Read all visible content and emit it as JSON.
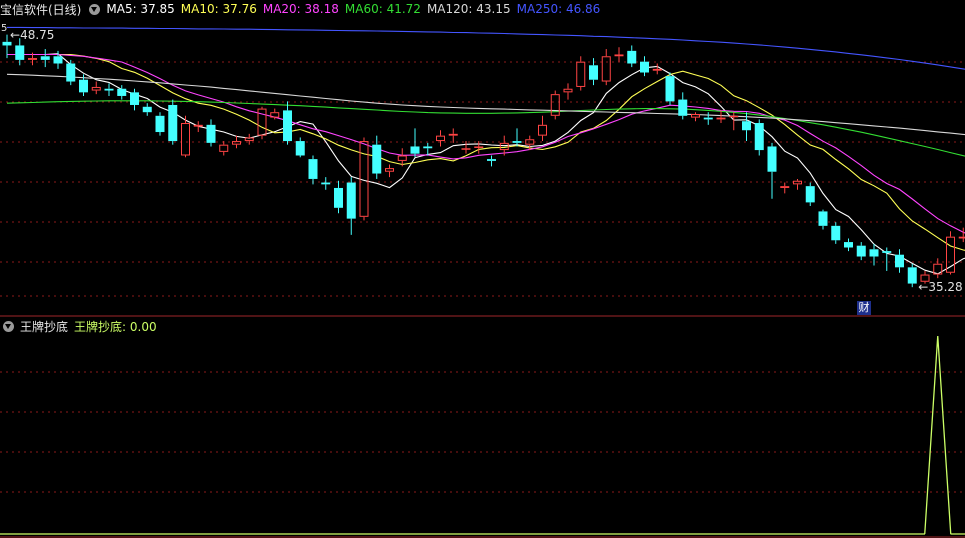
{
  "header": {
    "title": "宝信软件(日线)",
    "ma": [
      {
        "label": "MA5: 37.85",
        "color": "#ffffff"
      },
      {
        "label": "MA10: 37.76",
        "color": "#ffff55"
      },
      {
        "label": "MA20: 38.18",
        "color": "#ff44ff"
      },
      {
        "label": "MA60: 41.72",
        "color": "#33dd33"
      },
      {
        "label": "MA120: 43.15",
        "color": "#d8d8d8"
      },
      {
        "label": "MA250: 46.86",
        "color": "#4455ff"
      }
    ]
  },
  "indicator": {
    "name": "王牌抄底",
    "value_label": "王牌抄底: 0.00",
    "color": "#ccff66"
  },
  "annotations": {
    "high_label": "48.75",
    "low_label": "35.28",
    "left_axis_label": "5",
    "badge": "财"
  },
  "colors": {
    "up": "#ff4444",
    "down": "#44ffff",
    "grid": "#8b1a1a"
  },
  "chart_data": {
    "type": "candlestick",
    "ylim": [
      34.2,
      49.5
    ],
    "candles": [
      [
        48.4,
        48.2,
        48.8,
        47.5
      ],
      [
        48.2,
        47.4,
        48.6,
        47.1
      ],
      [
        47.4,
        47.5,
        47.8,
        47.1
      ],
      [
        47.6,
        47.4,
        48.0,
        47.0
      ],
      [
        47.6,
        47.2,
        47.9,
        46.9
      ],
      [
        47.2,
        46.2,
        47.4,
        46.0
      ],
      [
        46.3,
        45.6,
        46.6,
        45.4
      ],
      [
        45.7,
        45.9,
        46.2,
        45.5
      ],
      [
        45.8,
        45.7,
        46.1,
        45.4
      ],
      [
        45.8,
        45.4,
        46.0,
        45.2
      ],
      [
        45.6,
        44.9,
        45.8,
        44.6
      ],
      [
        44.8,
        44.5,
        45.0,
        44.3
      ],
      [
        44.3,
        43.4,
        44.5,
        43.2
      ],
      [
        44.9,
        42.9,
        45.2,
        42.7
      ],
      [
        42.1,
        43.9,
        44.3,
        42.0
      ],
      [
        43.7,
        43.8,
        44.0,
        43.4
      ],
      [
        43.8,
        42.8,
        44.1,
        42.6
      ],
      [
        42.3,
        42.7,
        42.9,
        42.1
      ],
      [
        42.7,
        42.9,
        43.2,
        42.5
      ],
      [
        42.9,
        43.1,
        43.3,
        42.7
      ],
      [
        43.2,
        44.7,
        44.8,
        43.0
      ],
      [
        44.2,
        44.5,
        44.7,
        44.1
      ],
      [
        44.6,
        42.9,
        45.1,
        42.7
      ],
      [
        42.9,
        42.1,
        43.1,
        42.0
      ],
      [
        41.9,
        40.8,
        42.1,
        40.5
      ],
      [
        40.6,
        40.5,
        40.9,
        40.2
      ],
      [
        40.3,
        39.2,
        40.7,
        38.9
      ],
      [
        40.6,
        38.6,
        40.9,
        37.7
      ],
      [
        38.7,
        42.9,
        43.1,
        38.5
      ],
      [
        42.7,
        41.1,
        43.2,
        40.8
      ],
      [
        41.2,
        41.4,
        41.6,
        40.9
      ],
      [
        41.8,
        42.1,
        42.5,
        41.5
      ],
      [
        42.6,
        42.2,
        43.6,
        42.0
      ],
      [
        42.6,
        42.5,
        42.8,
        42.1
      ],
      [
        42.9,
        43.2,
        43.5,
        42.6
      ],
      [
        43.2,
        43.3,
        43.6,
        42.8
      ],
      [
        42.5,
        42.5,
        42.9,
        42.2
      ],
      [
        42.6,
        42.6,
        42.9,
        42.2
      ],
      [
        41.9,
        41.8,
        42.1,
        41.5
      ],
      [
        42.4,
        42.8,
        43.2,
        42.1
      ],
      [
        42.9,
        42.8,
        43.6,
        42.6
      ],
      [
        42.7,
        43.0,
        43.2,
        42.4
      ],
      [
        43.2,
        43.8,
        44.3,
        42.9
      ],
      [
        44.3,
        45.5,
        45.7,
        44.1
      ],
      [
        45.6,
        45.8,
        46.1,
        45.2
      ],
      [
        45.9,
        47.3,
        47.6,
        45.7
      ],
      [
        47.1,
        46.3,
        47.5,
        46.0
      ],
      [
        46.2,
        47.6,
        48.0,
        46.0
      ],
      [
        47.6,
        47.7,
        48.1,
        47.3
      ],
      [
        47.9,
        47.2,
        48.2,
        47.0
      ],
      [
        47.3,
        46.7,
        47.6,
        46.5
      ],
      [
        46.8,
        46.9,
        47.2,
        46.6
      ],
      [
        46.5,
        45.1,
        46.7,
        44.9
      ],
      [
        45.2,
        44.3,
        45.6,
        44.1
      ],
      [
        44.2,
        44.4,
        44.5,
        44.0
      ],
      [
        44.2,
        44.1,
        44.5,
        43.8
      ],
      [
        44.1,
        44.2,
        44.6,
        43.9
      ],
      [
        44.3,
        44.3,
        44.5,
        43.5
      ],
      [
        44.0,
        43.5,
        44.5,
        42.9
      ],
      [
        43.9,
        42.4,
        44.1,
        42.1
      ],
      [
        42.6,
        41.2,
        42.8,
        39.7
      ],
      [
        40.3,
        40.4,
        40.6,
        40.0
      ],
      [
        40.5,
        40.7,
        40.8,
        40.2
      ],
      [
        40.4,
        39.5,
        40.6,
        39.3
      ],
      [
        39.0,
        38.2,
        39.1,
        38.0
      ],
      [
        38.2,
        37.4,
        38.4,
        37.2
      ],
      [
        37.3,
        37.0,
        37.5,
        36.8
      ],
      [
        37.1,
        36.5,
        37.3,
        36.3
      ],
      [
        36.9,
        36.5,
        37.2,
        36.0
      ],
      [
        36.8,
        36.7,
        37.0,
        35.7
      ],
      [
        36.6,
        35.9,
        36.9,
        35.6
      ],
      [
        35.9,
        35.0,
        36.1,
        34.8
      ],
      [
        35.1,
        35.5,
        35.7,
        35.0
      ],
      [
        35.5,
        36.1,
        36.4,
        35.3
      ],
      [
        35.6,
        37.6,
        37.9,
        35.5
      ],
      [
        37.5,
        37.6,
        38.1,
        37.3
      ],
      [
        37.3,
        36.7,
        37.6,
        36.4
      ]
    ],
    "ma_lines": [
      {
        "name": "MA5",
        "color": "#ffffff",
        "values": [
          47.7,
          47.7,
          47.7,
          47.7,
          47.74,
          47.14,
          46.66,
          46.3,
          46.15,
          45.76,
          45.5,
          45.26,
          44.78,
          44.5,
          44.06,
          43.72,
          43.56,
          43.4,
          43.16,
          43.06,
          43.24,
          43.42,
          43.7,
          43.98,
          43.84,
          42.86,
          41.8,
          40.94,
          40.72,
          40.56,
          40.32,
          40.86,
          41.98,
          42.16,
          42.26,
          42.64,
          42.72,
          42.74,
          42.68,
          42.64,
          42.7,
          42.6,
          42.66,
          42.9,
          43.38,
          44.04,
          44.48,
          45.54,
          46.14,
          46.58,
          46.96,
          47.04,
          46.64,
          46.14,
          45.9,
          45.52,
          44.82,
          44.06,
          44.08,
          43.74,
          43.14,
          42.34,
          41.96,
          41.12,
          40.0,
          39.1,
          38.72,
          37.98,
          37.18,
          36.68,
          36.52,
          36.12,
          35.74,
          35.54,
          35.94,
          36.38,
          36.58
        ]
      },
      {
        "name": "MA10",
        "color": "#ffff55",
        "values": [
          47.7,
          47.7,
          47.7,
          47.7,
          47.7,
          47.7,
          47.61,
          47.48,
          47.3,
          46.92,
          46.71,
          46.38,
          45.98,
          45.57,
          45.25,
          45.0,
          44.88,
          44.67,
          44.39,
          44.06,
          43.66,
          43.36,
          43.41,
          43.54,
          43.3,
          43.02,
          42.67,
          42.41,
          42.19,
          42.05,
          41.76,
          41.6,
          41.71,
          41.86,
          41.93,
          41.8,
          42.09,
          42.44,
          42.53,
          42.55,
          42.65,
          42.52,
          42.43,
          42.58,
          42.83,
          43.4,
          43.61,
          44.04,
          44.66,
          45.36,
          45.8,
          46.2,
          46.59,
          46.77,
          46.57,
          46.37,
          45.99,
          45.41,
          45.14,
          44.75,
          44.34,
          43.81,
          43.23,
          42.68,
          42.44,
          41.88,
          41.36,
          40.77,
          40.42,
          40.01,
          39.14,
          38.47,
          38.02,
          37.54,
          37.08,
          36.86,
          36.73
        ]
      },
      {
        "name": "MA20",
        "color": "#ff44ff",
        "values": [
          47.7,
          47.7,
          47.7,
          47.7,
          47.7,
          47.65,
          47.6,
          47.5,
          47.4,
          47.28,
          47.0,
          46.7,
          46.36,
          45.99,
          45.68,
          45.46,
          45.26,
          45.06,
          44.8,
          44.58,
          44.4,
          44.22,
          44.03,
          43.8,
          43.58,
          43.42,
          43.2,
          42.98,
          42.74,
          42.48,
          42.24,
          42.11,
          42.12,
          42.13,
          42.01,
          41.91,
          41.97,
          42.11,
          42.17,
          42.24,
          42.31,
          42.44,
          42.58,
          42.83,
          43.15,
          43.36,
          43.58,
          43.83,
          44.09,
          44.39,
          44.57,
          44.72,
          44.89,
          44.85,
          44.79,
          44.71,
          44.59,
          44.55,
          44.54,
          44.44,
          44.23,
          44.06,
          43.76,
          43.32,
          42.89,
          42.52,
          42.05,
          41.54,
          41.0,
          40.55,
          40.22,
          39.69,
          39.14,
          38.6,
          38.2,
          37.85,
          37.52
        ]
      },
      {
        "name": "MA60",
        "color": "#33dd33",
        "values": [
          45.0,
          45.02,
          45.04,
          45.06,
          45.08,
          45.1,
          45.11,
          45.12,
          45.13,
          45.13,
          45.13,
          45.13,
          45.12,
          45.11,
          45.1,
          45.08,
          45.06,
          45.04,
          45.01,
          44.98,
          44.95,
          44.92,
          44.89,
          44.86,
          44.82,
          44.78,
          44.74,
          44.7,
          44.66,
          44.62,
          44.58,
          44.54,
          44.51,
          44.48,
          44.46,
          44.45,
          44.44,
          44.44,
          44.44,
          44.45,
          44.46,
          44.48,
          44.5,
          44.53,
          44.56,
          44.59,
          44.62,
          44.65,
          44.67,
          44.69,
          44.7,
          44.7,
          44.69,
          44.67,
          44.64,
          44.6,
          44.55,
          44.49,
          44.42,
          44.34,
          44.25,
          44.15,
          44.04,
          43.92,
          43.8,
          43.67,
          43.53,
          43.39,
          43.24,
          43.08,
          42.92,
          42.76,
          42.6,
          42.43,
          42.26,
          42.09,
          41.92
        ]
      },
      {
        "name": "MA120",
        "color": "#d8d8d8",
        "values": [
          46.6,
          46.58,
          46.55,
          46.52,
          46.49,
          46.45,
          46.41,
          46.37,
          46.33,
          46.28,
          46.23,
          46.18,
          46.13,
          46.07,
          46.01,
          45.95,
          45.89,
          45.82,
          45.75,
          45.68,
          45.61,
          45.54,
          45.47,
          45.4,
          45.33,
          45.26,
          45.19,
          45.12,
          45.06,
          45.0,
          44.95,
          44.9,
          44.86,
          44.82,
          44.79,
          44.76,
          44.73,
          44.71,
          44.69,
          44.67,
          44.65,
          44.63,
          44.61,
          44.59,
          44.57,
          44.55,
          44.53,
          44.51,
          44.49,
          44.47,
          44.45,
          44.43,
          44.41,
          44.39,
          44.37,
          44.34,
          44.31,
          44.28,
          44.25,
          44.21,
          44.17,
          44.13,
          44.08,
          44.03,
          43.98,
          43.92,
          43.86,
          43.8,
          43.74,
          43.68,
          43.62,
          43.55,
          43.48,
          43.41,
          43.34,
          43.27,
          43.2
        ]
      },
      {
        "name": "MA250",
        "color": "#4455ff",
        "values": [
          49.2,
          49.2,
          49.19,
          49.19,
          49.18,
          49.18,
          49.17,
          49.17,
          49.16,
          49.16,
          49.15,
          49.15,
          49.14,
          49.14,
          49.13,
          49.12,
          49.12,
          49.11,
          49.1,
          49.1,
          49.09,
          49.08,
          49.07,
          49.06,
          49.05,
          49.04,
          49.03,
          49.02,
          49.01,
          49.0,
          48.99,
          48.98,
          48.96,
          48.95,
          48.94,
          48.92,
          48.91,
          48.89,
          48.88,
          48.86,
          48.84,
          48.82,
          48.8,
          48.78,
          48.76,
          48.74,
          48.71,
          48.69,
          48.66,
          48.63,
          48.6,
          48.57,
          48.54,
          48.5,
          48.46,
          48.42,
          48.38,
          48.33,
          48.28,
          48.23,
          48.17,
          48.11,
          48.05,
          47.98,
          47.91,
          47.84,
          47.76,
          47.68,
          47.6,
          47.51,
          47.42,
          47.32,
          47.22,
          47.12,
          47.01,
          46.9,
          46.78
        ]
      }
    ],
    "indicator_series": {
      "name": "王牌抄底",
      "ylim": [
        0,
        1
      ],
      "spike_index": 73,
      "values": [
        0,
        0,
        0,
        0,
        0,
        0,
        0,
        0,
        0,
        0,
        0,
        0,
        0,
        0,
        0,
        0,
        0,
        0,
        0,
        0,
        0,
        0,
        0,
        0,
        0,
        0,
        0,
        0,
        0,
        0,
        0,
        0,
        0,
        0,
        0,
        0,
        0,
        0,
        0,
        0,
        0,
        0,
        0,
        0,
        0,
        0,
        0,
        0,
        0,
        0,
        0,
        0,
        0,
        0,
        0,
        0,
        0,
        0,
        0,
        0,
        0,
        0,
        0,
        0,
        0,
        0,
        0,
        0,
        0,
        0,
        0,
        0,
        0,
        1,
        0,
        0,
        0
      ]
    }
  }
}
